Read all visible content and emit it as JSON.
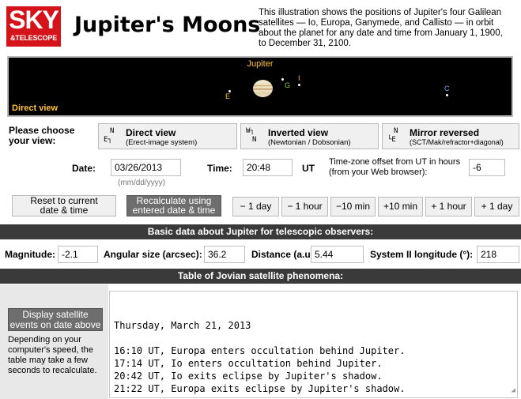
{
  "header": {
    "logo_line1": "SKY",
    "logo_line2": "&TELESCOPE",
    "title": "Jupiter's Moons",
    "intro": "This illustration shows the positions of Jupiter's four Galilean satellites — Io, Europa, Ganymede, and Callisto — in orbit about the planet for any date and time from January 1, 1900, to December 31, 2100."
  },
  "sky_view": {
    "planet_label": "Jupiter",
    "view_label": "Direct view",
    "moons": [
      {
        "id": "E",
        "label": "E",
        "color": "#ffc234"
      },
      {
        "id": "G",
        "label": "G",
        "color": "#8ed23a"
      },
      {
        "id": "I",
        "label": "I",
        "color": "#ffc234"
      },
      {
        "id": "C",
        "label": "C",
        "color": "#5ea5ff"
      }
    ]
  },
  "view_chooser": {
    "prompt": "Please choose your view:",
    "options": [
      {
        "name": "Direct view",
        "sub": "(Erect-image system)",
        "orient_top": "N",
        "orient_bottom": "E┐"
      },
      {
        "name": "Inverted view",
        "sub": "(Newtonian / Dobsonian)",
        "orient_top": "W┐",
        "orient_bottom": "N"
      },
      {
        "name": "Mirror reversed",
        "sub": "(SCT/Mak/refractor+diagonal)",
        "orient_top": "N",
        "orient_bottom": "└E"
      }
    ]
  },
  "datetime": {
    "date_label": "Date:",
    "date_value": "03/26/2013",
    "date_hint": "(mm/dd/yyyy)",
    "time_label": "Time:",
    "time_value": "20:48",
    "time_unit": "UT",
    "tz_note": "Time-zone offset from UT in hours (from your Web browser):",
    "tz_value": "-6"
  },
  "buttons": {
    "reset_line1": "Reset to current",
    "reset_line2": "date & time",
    "recalc_line1": "Recalculate using",
    "recalc_line2": "entered date & time",
    "step": [
      "− 1 day",
      "− 1 hour",
      "−10 min",
      "+10 min",
      "+ 1 hour",
      "+ 1 day"
    ]
  },
  "basic_data": {
    "heading": "Basic data about Jupiter for telescopic observers:",
    "magnitude_label": "Magnitude:",
    "magnitude_value": "-2.1",
    "angular_label": "Angular size (arcsec):",
    "angular_value": "36.2",
    "distance_label": "Distance (a.u.):",
    "distance_value": "5.44",
    "longitude_label": "System II longitude (°):",
    "longitude_value": "218"
  },
  "phenomena": {
    "heading": "Table of Jovian satellite phenomena:",
    "display_line1": "Display satellite",
    "display_line2": "events on date above",
    "speed_note": "Depending on your computer's speed, the table may take a few seconds to recalculate.",
    "results_text": "Thursday, March 21, 2013\n\n16:10 UT, Europa enters occultation behind Jupiter.\n17:14 UT, Io enters occultation behind Jupiter.\n20:42 UT, Io exits eclipse by Jupiter's shadow.\n21:22 UT, Europa exits eclipse by Jupiter's shadow."
  }
}
